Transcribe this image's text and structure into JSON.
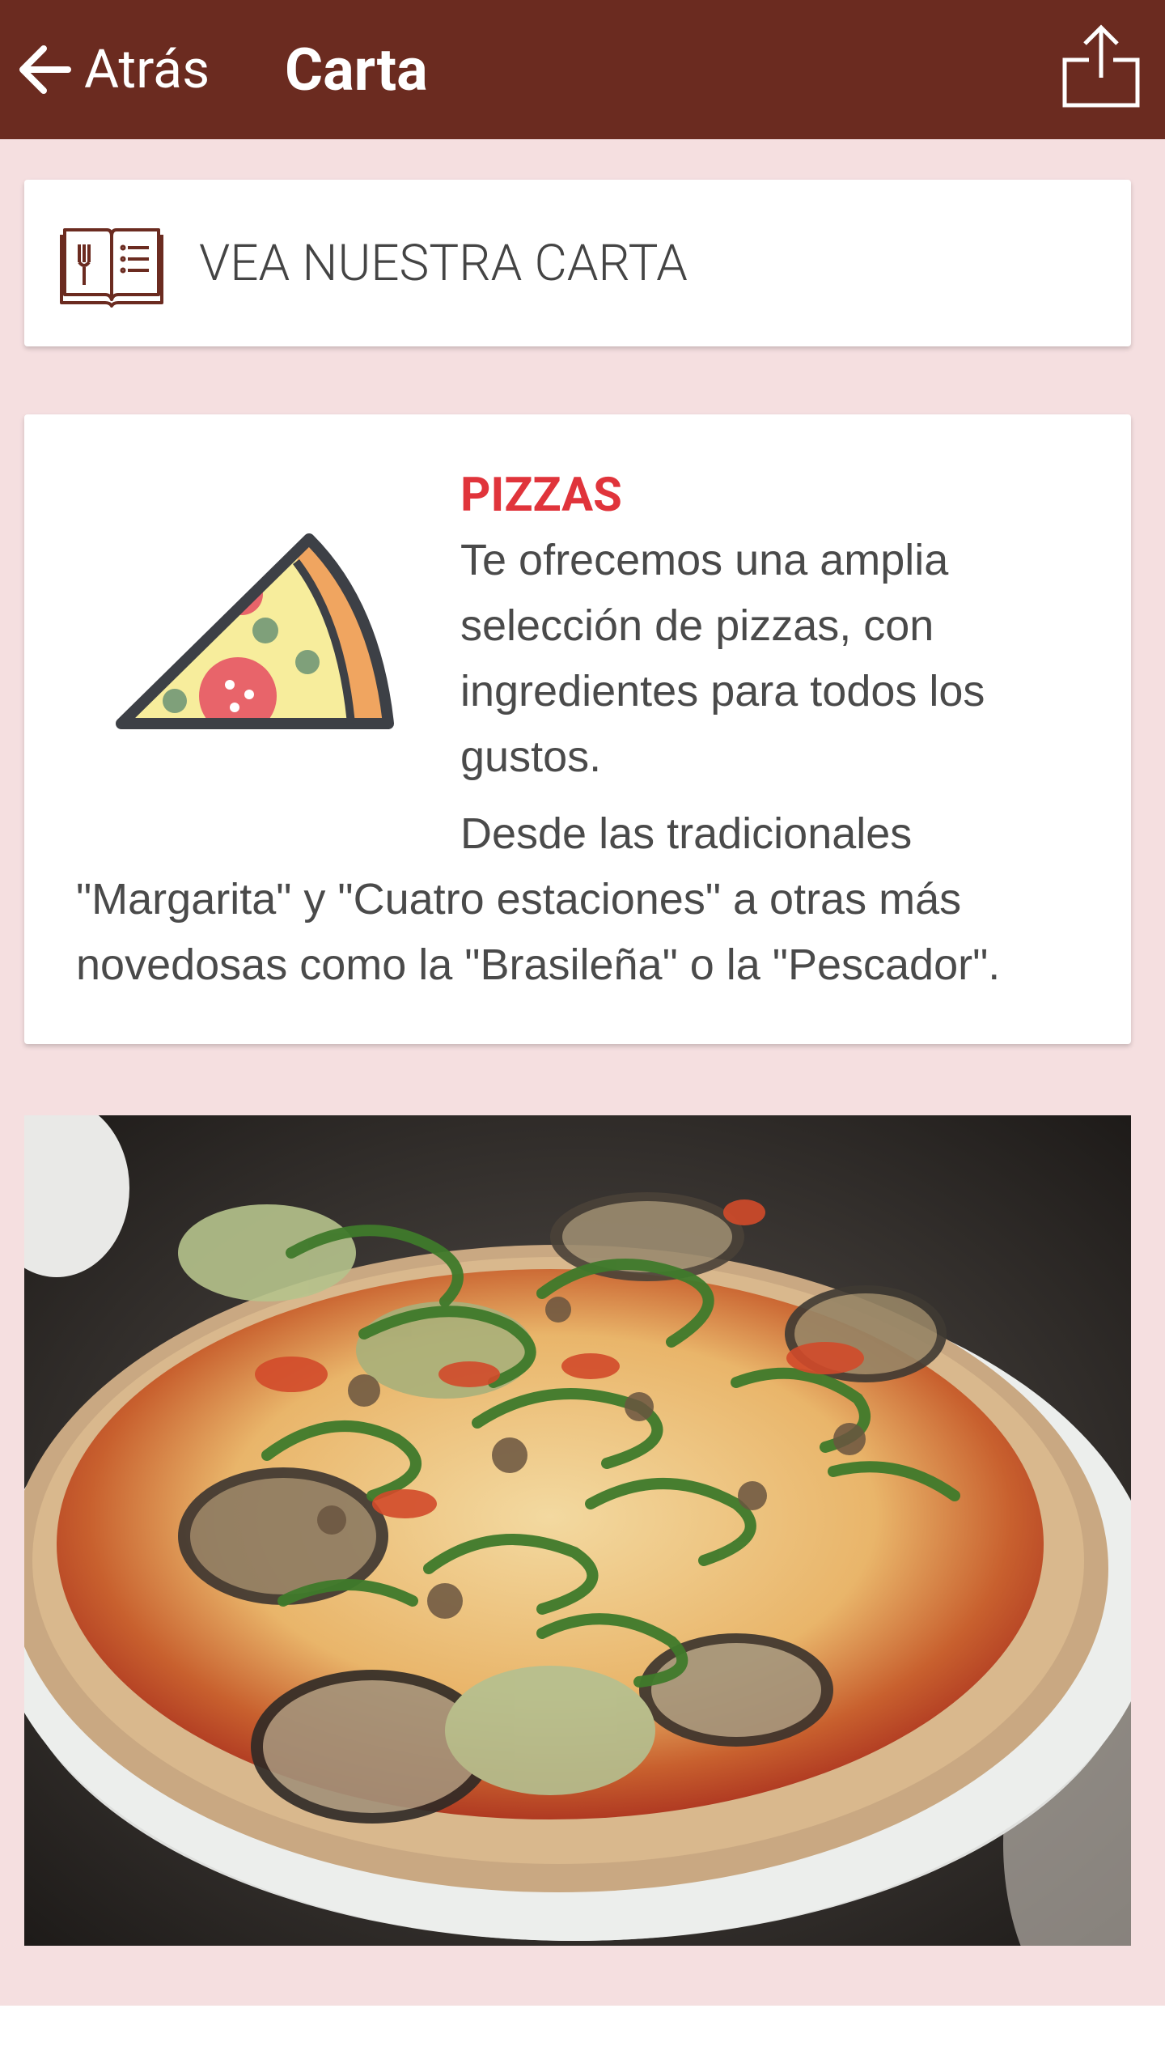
{
  "header": {
    "back_label": "Atrás",
    "title": "Carta",
    "bar_color": "#6b2b20",
    "back_icon": "arrow-left-icon",
    "share_icon": "share-icon"
  },
  "menu_link": {
    "label": "VEA NUESTRA CARTA",
    "icon": "menu-book-icon"
  },
  "pizza_section": {
    "icon": "pizza-slice-icon",
    "heading": "PIZZAS",
    "heading_color": "#e0343b",
    "paragraph1": "Te ofrecemos una amplia selección de pizzas, con ingredientes para todos los gustos.",
    "paragraph2": "Desde las tradicionales \"Margarita\" y \"Cuatro estaciones\" a otras más novedosas como la \"Brasileña\" o la \"Pescador\"."
  },
  "photo": {
    "subject": "pizza-photo"
  },
  "colors": {
    "page_background": "#f5dfe0",
    "card_background": "#ffffff"
  }
}
